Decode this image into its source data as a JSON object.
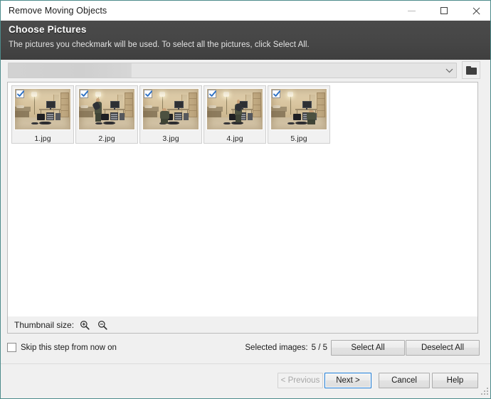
{
  "window": {
    "title": "Remove Moving Objects",
    "controls": {
      "minimize": "minimize-button",
      "maximize": "maximize-button",
      "close": "close-button"
    },
    "border_color": "#4d8b8b"
  },
  "banner": {
    "title": "Choose Pictures",
    "subtitle": "The pictures you checkmark will be used. To select all the pictures, click Select All.",
    "background_color": "#464646"
  },
  "path_row": {
    "combo_value": "",
    "combo_placeholder": "",
    "browse_button_label": ""
  },
  "pictures": [
    {
      "label": "1.jpg",
      "checked": true,
      "variant": "empty"
    },
    {
      "label": "2.jpg",
      "checked": true,
      "variant": "standing"
    },
    {
      "label": "3.jpg",
      "checked": true,
      "variant": "sitting"
    },
    {
      "label": "4.jpg",
      "checked": true,
      "variant": "standing-right"
    },
    {
      "label": "5.jpg",
      "checked": true,
      "variant": "kneeling-right"
    }
  ],
  "thumbnail_bar": {
    "label": "Thumbnail size:",
    "zoom_in_icon": "magnifier-plus-icon",
    "zoom_out_icon": "magnifier-minus-icon"
  },
  "selection_row": {
    "skip_label": "Skip this step from now on",
    "skip_checked": false,
    "selected_label": "Selected images:",
    "selected_value": "5 / 5",
    "select_all_label": "Select All",
    "deselect_all_label": "Deselect All"
  },
  "footer": {
    "previous_label": "< Previous",
    "previous_disabled": true,
    "next_label": "Next >",
    "next_is_default": true,
    "cancel_label": "Cancel",
    "help_label": "Help"
  }
}
